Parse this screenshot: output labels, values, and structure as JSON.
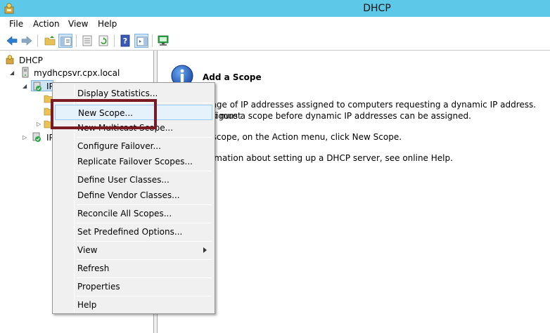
{
  "window": {
    "title": "DHCP"
  },
  "menubar": {
    "items": [
      "File",
      "Action",
      "View",
      "Help"
    ]
  },
  "toolbar": {
    "buttons": [
      "back-icon",
      "forward-icon",
      "up-folder-icon",
      "show-hide-tree-icon",
      "export-list-icon",
      "refresh-icon",
      "help-icon",
      "action-pane-icon",
      "computer-icon"
    ]
  },
  "tree": {
    "root": "DHCP",
    "server": "mydhcpsvr.cpx.local",
    "ipv4": "IPv4",
    "ipv6": "IPv6"
  },
  "content": {
    "heading": "Add a Scope",
    "para1_line1": "range of IP addresses assigned to computers requesting a dynamic IP address. You must",
    "para1_line2": "onfigure a scope before dynamic IP addresses can be assigned.",
    "para2": "w scope, on the Action menu, click New Scope.",
    "para3": "formation about setting up a DHCP server, see online Help."
  },
  "context_menu": {
    "display_statistics": "Display Statistics...",
    "new_scope": "New Scope...",
    "new_multicast_scope": "New Multicast Scope...",
    "configure_failover": "Configure Failover...",
    "replicate_failover_scopes": "Replicate Failover Scopes...",
    "define_user_classes": "Define User Classes...",
    "define_vendor_classes": "Define Vendor Classes...",
    "reconcile_all_scopes": "Reconcile All Scopes...",
    "set_predefined_options": "Set Predefined Options...",
    "view": "View",
    "refresh": "Refresh",
    "properties": "Properties",
    "help": "Help"
  },
  "colors": {
    "titlebar": "#5ec8e8",
    "highlight": "#e5f1fb",
    "callout": "#7a1a22"
  }
}
